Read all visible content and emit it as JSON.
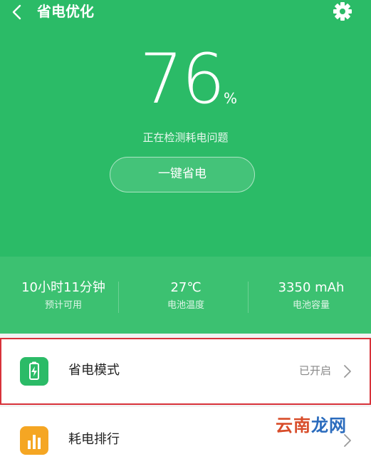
{
  "header": {
    "title": "省电优化"
  },
  "battery": {
    "percent": "76",
    "unit": "%",
    "status": "正在检测耗电问题",
    "optimize_button": "一键省电"
  },
  "stats": [
    {
      "value": "10小时11分钟",
      "label": "预计可用"
    },
    {
      "value": "27℃",
      "label": "电池温度"
    },
    {
      "value": "3350 mAh",
      "label": "电池容量"
    }
  ],
  "list": [
    {
      "label": "省电模式",
      "status": "已开启",
      "icon": "battery-charging-icon"
    },
    {
      "label": "耗电排行",
      "status": "",
      "icon": "bar-chart-icon"
    }
  ],
  "watermark": {
    "part1": "云南",
    "part2": "龙网"
  },
  "colors": {
    "accent": "#2bbb67",
    "highlight_border": "#d8323a",
    "ranking_icon": "#f5a623"
  }
}
